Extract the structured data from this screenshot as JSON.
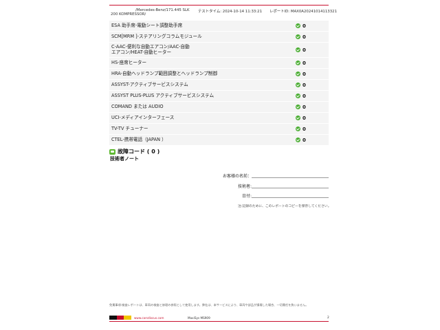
{
  "header": {
    "vehicle_line1": "/Mercedes-Benz/171.445 SLK",
    "vehicle_line2": "200 KOMPRESSOR/",
    "test_time": "テストタイム:  2024-10-14 11:33:21",
    "report_id": "レポートID:  MAX0A20241014113321"
  },
  "systems": [
    {
      "name": "ESA 助手席-電動シート調整助手席",
      "count": "0"
    },
    {
      "name": "SCM[MRM ]-ステアリングコラムモジュール",
      "count": "0"
    },
    {
      "name": "C-AAC-便利な自動エアコン/AAC-自動エアコン/HEAT-自動ヒーター",
      "count": "0"
    },
    {
      "name": "HS-座席ヒーター",
      "count": "0"
    },
    {
      "name": "HRA-自動ヘッドランプ範囲調整とヘッドランプ制御",
      "count": "0"
    },
    {
      "name": "ASSYST-アクティブサービスシステム",
      "count": "0"
    },
    {
      "name": "ASSYST PLUS-PLUS アクティブサービスシステム",
      "count": "0"
    },
    {
      "name": "COMAND または AUDIO",
      "count": "0"
    },
    {
      "name": "UCI-メディアインターフェース",
      "count": "0"
    },
    {
      "name": "TV-TV チューナー",
      "count": "0"
    },
    {
      "name": "CTEL-携帯電話（JAPAN ）",
      "count": "0"
    }
  ],
  "fault_codes": {
    "title": "故障コード ( 0 )"
  },
  "technician_notes": {
    "title": "技術者ノート"
  },
  "signature": {
    "customer_label": "お客様の名前：",
    "technician_label": "技術者:",
    "date_label": "日付:",
    "remark": "注:記録のために、このレポートのコピーを保存してください。"
  },
  "footer": {
    "disclaimer": "免責事項:検査レポートは、車両の検査と修理の参照として使用します。弊社は、本サービスにより、車両や部品が損壊した場合、一切責任を負いません。",
    "website": "www.carsdiscus.com",
    "model": "MaxiSys MS909",
    "page": "2"
  },
  "colors": {
    "accent": "#c8102e",
    "ok": "#4cae34",
    "row_bg": "#f4f4f4"
  }
}
